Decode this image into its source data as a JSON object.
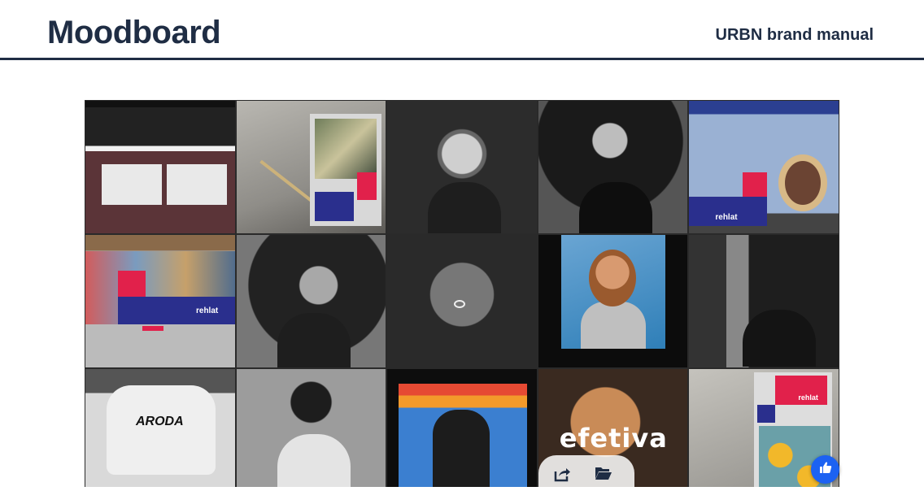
{
  "header": {
    "title": "Moodboard",
    "subtitle": "URBN brand manual"
  },
  "gallery": {
    "tiles": [
      {
        "kind": "business-cards-mockup"
      },
      {
        "kind": "stairway-poster"
      },
      {
        "kind": "bw-portrait-glasses"
      },
      {
        "kind": "bw-portrait-sitting"
      },
      {
        "kind": "billboard-paris",
        "text": "rehlat"
      },
      {
        "kind": "street-billboard",
        "text": "rehlat"
      },
      {
        "kind": "bw-portrait-curly"
      },
      {
        "kind": "bw-cap-closeup"
      },
      {
        "kind": "color-portrait-laughing"
      },
      {
        "kind": "bw-man-sunglasses"
      },
      {
        "kind": "bw-white-tee",
        "text": "ARODA"
      },
      {
        "kind": "bw-cap-boy"
      },
      {
        "kind": "color-stripes-portrait"
      },
      {
        "kind": "efetiva-typography",
        "text": "efetiva"
      },
      {
        "kind": "subway-poster",
        "text": "rehlat"
      }
    ]
  },
  "actions": {
    "share_icon": "share-icon",
    "folder_icon": "folder-open-icon",
    "like_icon": "thumbs-up-icon",
    "like_color": "#1c62f2"
  }
}
